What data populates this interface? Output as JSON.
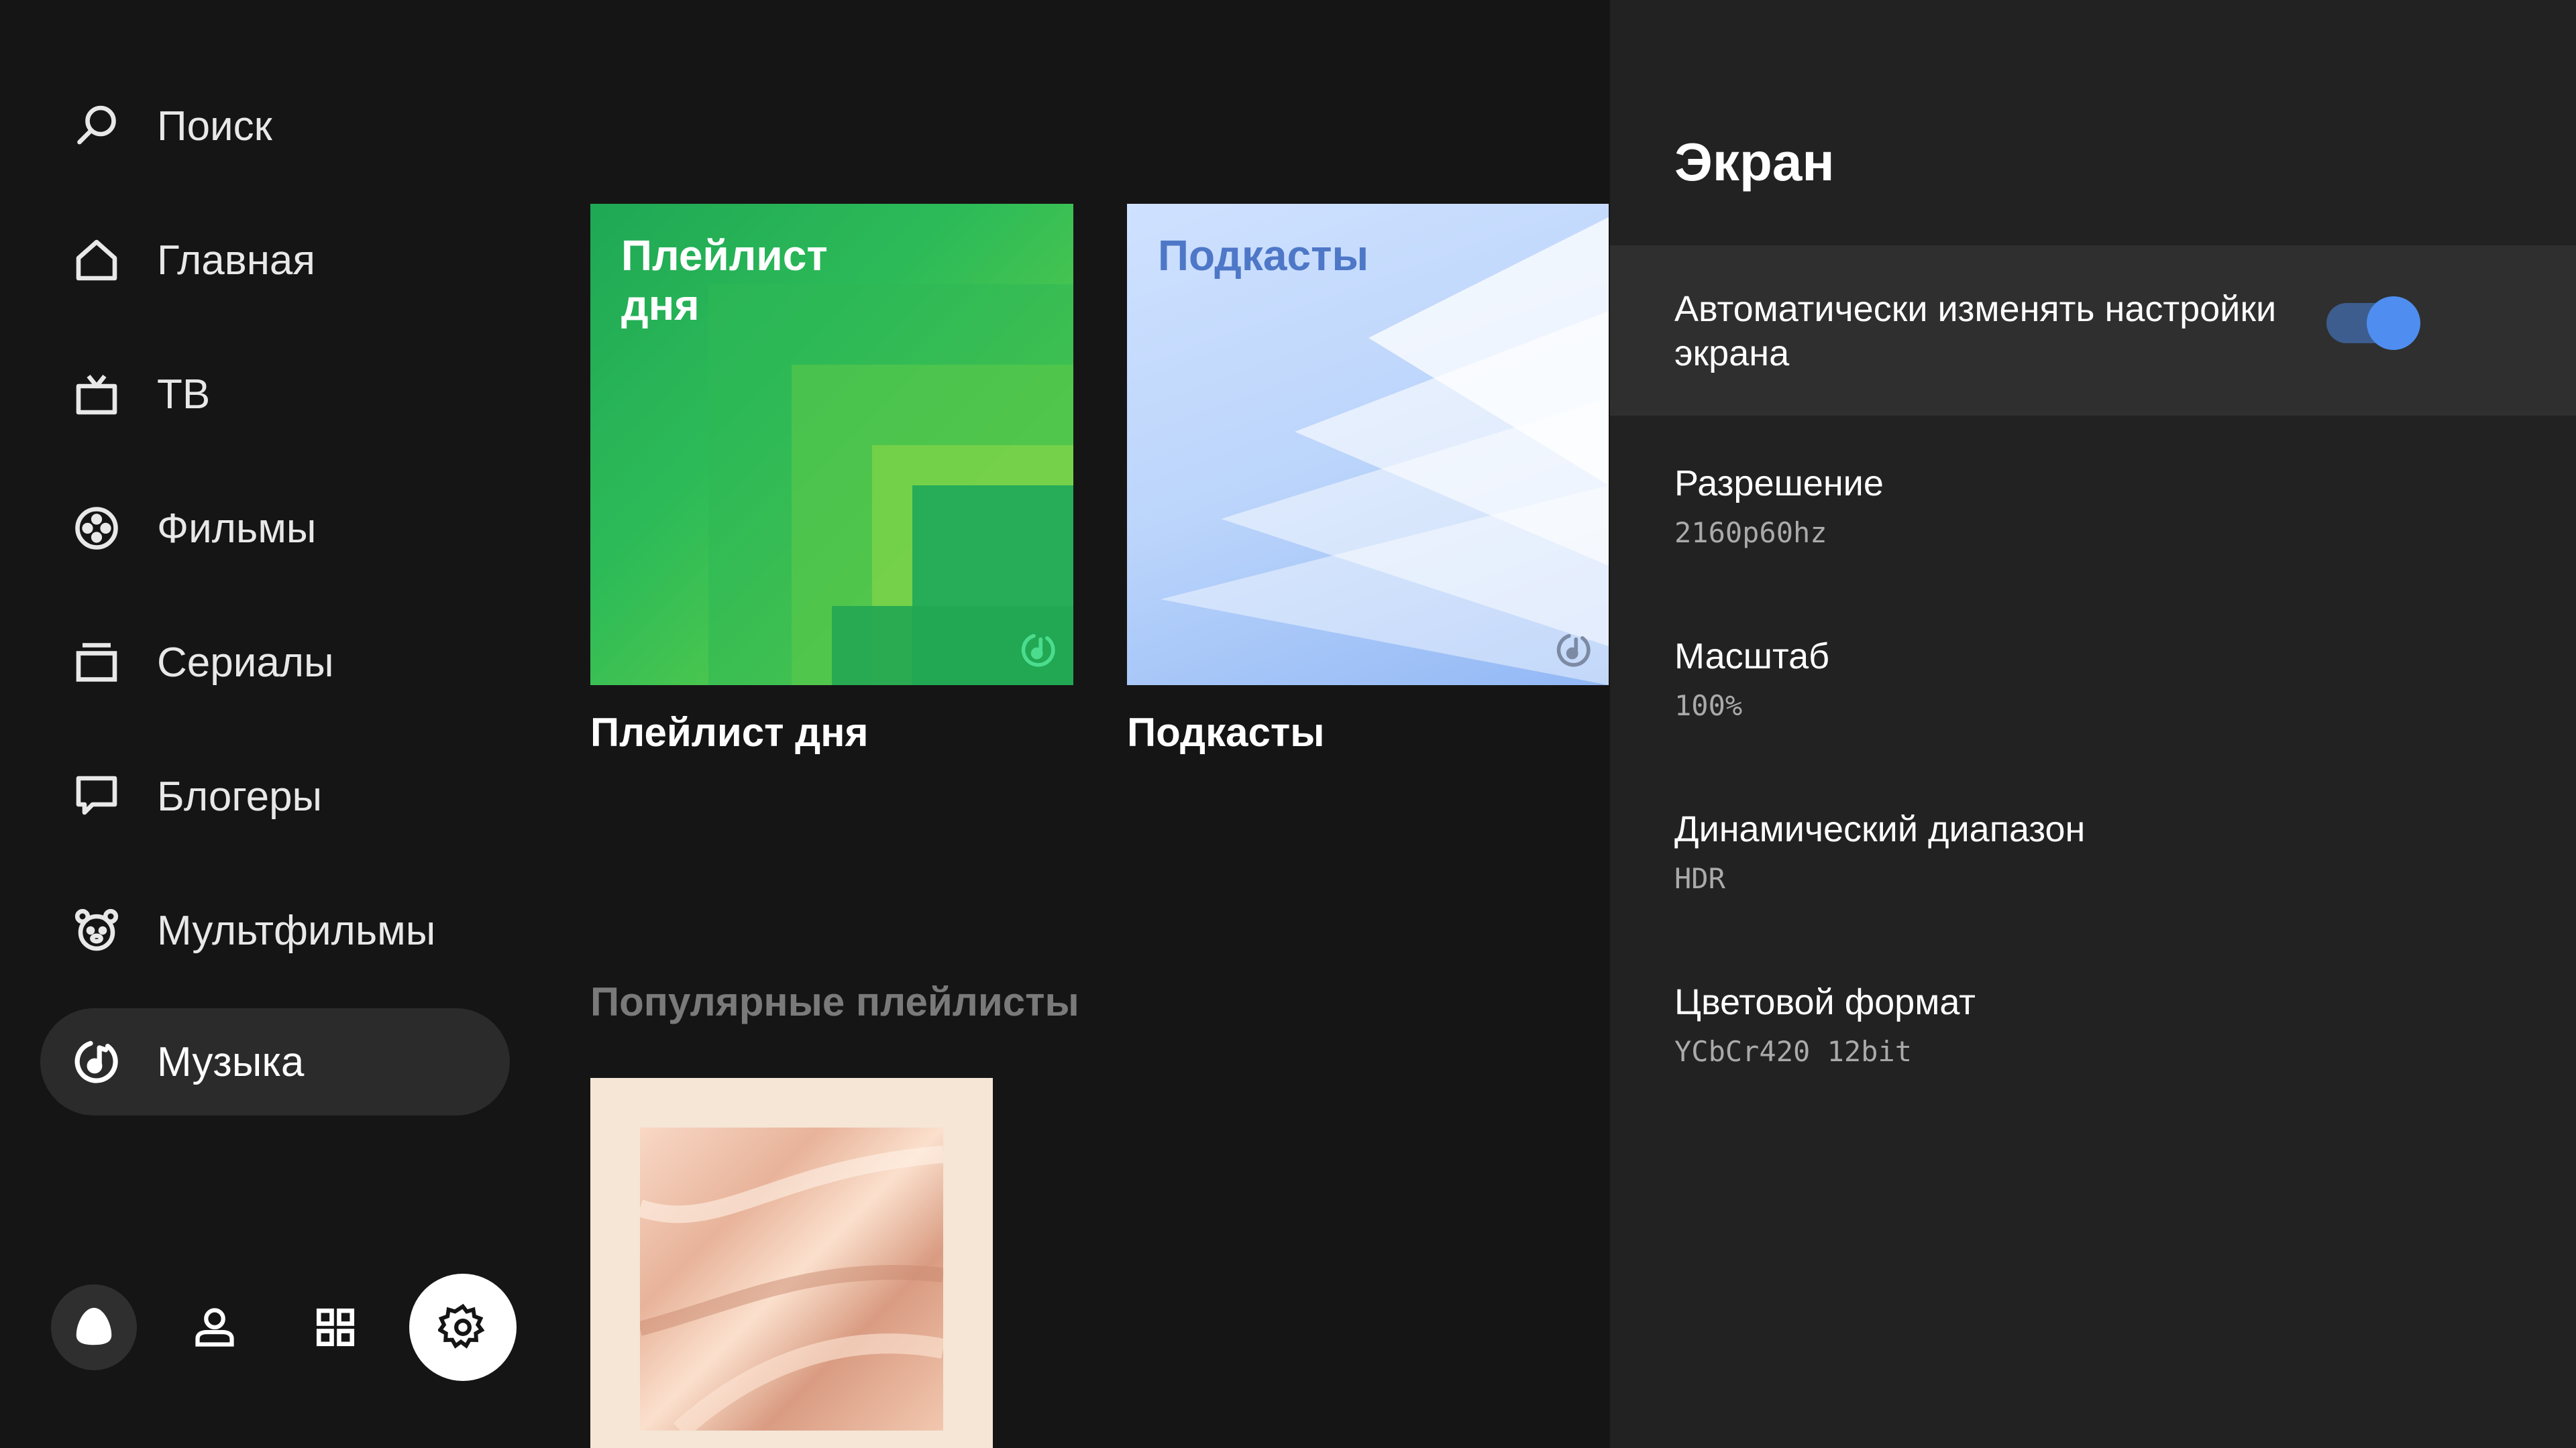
{
  "sidebar": {
    "items": [
      {
        "label": "Поиск",
        "icon": "search-icon"
      },
      {
        "label": "Главная",
        "icon": "home-icon"
      },
      {
        "label": "ТВ",
        "icon": "tv-icon"
      },
      {
        "label": "Фильмы",
        "icon": "film-reel-icon"
      },
      {
        "label": "Сериалы",
        "icon": "series-icon"
      },
      {
        "label": "Блогеры",
        "icon": "chat-bubble-icon"
      },
      {
        "label": "Мультфильмы",
        "icon": "bear-icon"
      },
      {
        "label": "Музыка",
        "icon": "music-icon",
        "active": true
      }
    ],
    "bottom_icons": [
      "alice-icon",
      "profile-icon",
      "apps-grid-icon",
      "gear-icon"
    ]
  },
  "content": {
    "cards": [
      {
        "title": "Плейлист\nдня",
        "caption": "Плейлист дня"
      },
      {
        "title": "Подкасты",
        "caption": "Подкасты"
      }
    ],
    "section_title": "Популярные плейлисты"
  },
  "panel": {
    "title": "Экран",
    "auto_setting": {
      "label": "Автоматически изменять настройки экрана",
      "enabled": true
    },
    "settings": [
      {
        "label": "Разрешение",
        "value": "2160p60hz"
      },
      {
        "label": "Масштаб",
        "value": "100%"
      },
      {
        "label": "Динамический диапазон",
        "value": "HDR"
      },
      {
        "label": "Цветовой формат",
        "value": "YCbCr420 12bit"
      }
    ]
  },
  "colors": {
    "background": "#151515",
    "panel": "#222222",
    "active_nav": "#2b2b2b",
    "toggle_accent": "#4f8ef0",
    "green_card": "#2dbb58",
    "blue_card": "#bcd5fb"
  }
}
